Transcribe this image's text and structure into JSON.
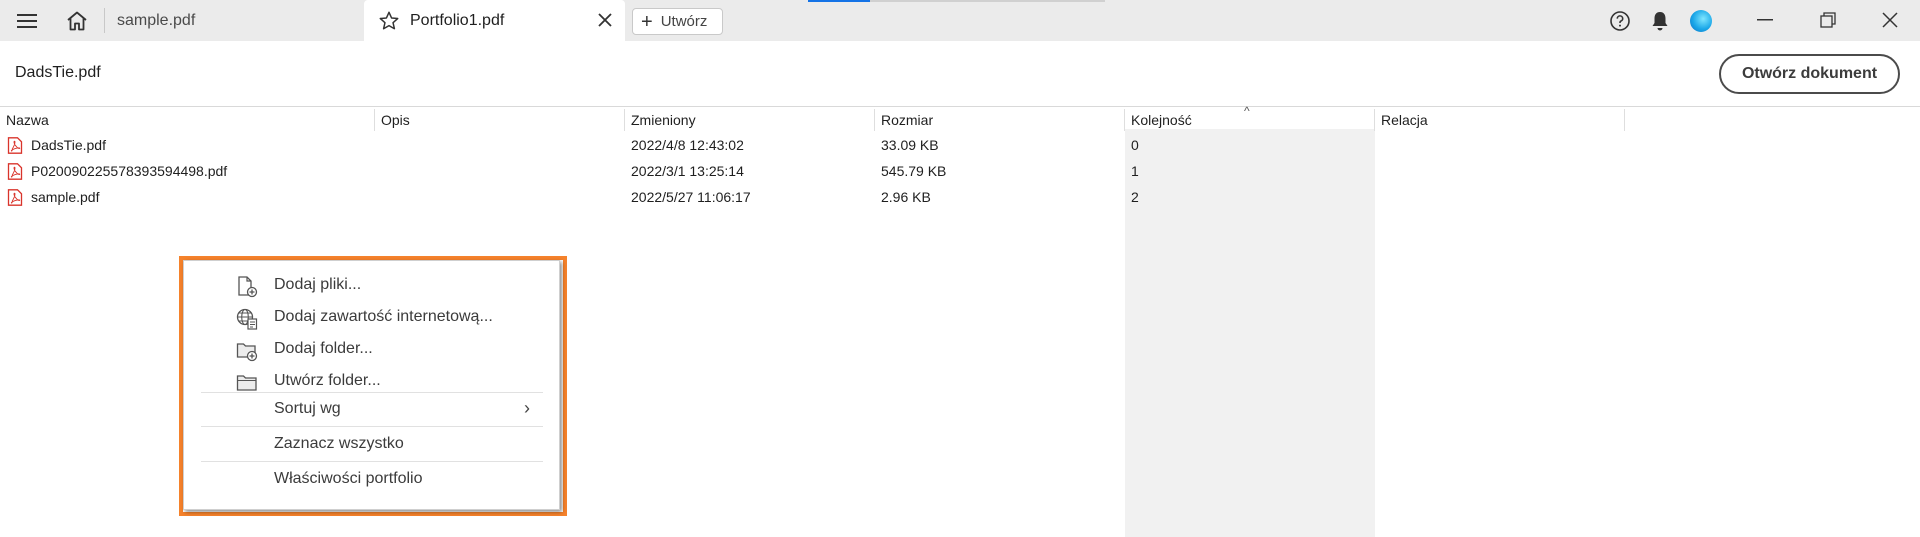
{
  "tabs": [
    {
      "label": "sample.pdf",
      "active": false
    },
    {
      "label": "Portfolio1.pdf",
      "active": true
    }
  ],
  "toolbar": {
    "create_label": "Utwórz"
  },
  "header": {
    "doc_title": "DadsTie.pdf",
    "open_button": "Otwórz dokument"
  },
  "table": {
    "columns": [
      "Nazwa",
      "Opis",
      "Zmieniony",
      "Rozmiar",
      "Kolejność",
      "Relacja"
    ],
    "sorted_column": "Kolejność",
    "rows": [
      {
        "name": "DadsTie.pdf",
        "modified": "2022/4/8 12:43:02",
        "size": "33.09 KB",
        "order": "0"
      },
      {
        "name": "P020090225578393594498.pdf",
        "modified": "2022/3/1 13:25:14",
        "size": "545.79 KB",
        "order": "1"
      },
      {
        "name": "sample.pdf",
        "modified": "2022/5/27 11:06:17",
        "size": "2.96 KB",
        "order": "2"
      }
    ]
  },
  "context_menu": {
    "items": [
      {
        "label": "Dodaj pliki...",
        "icon": "add-file-icon"
      },
      {
        "label": "Dodaj zawartość internetową...",
        "icon": "web-content-icon"
      },
      {
        "label": "Dodaj folder...",
        "icon": "add-folder-icon"
      },
      {
        "label": "Utwórz folder...",
        "icon": "folder-icon"
      },
      {
        "label": "Sortuj wg",
        "icon": "",
        "submenu": true
      },
      {
        "label": "Zaznacz wszystko",
        "icon": ""
      },
      {
        "label": "Właściwości portfolio",
        "icon": ""
      }
    ]
  },
  "colors": {
    "highlight": "#f5822b",
    "pdf_red": "#d9342b",
    "accent": "#1473e6"
  }
}
